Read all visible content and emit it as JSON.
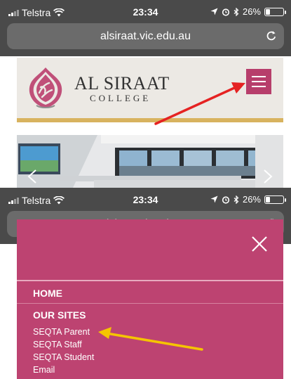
{
  "status_bar": {
    "carrier": "Telstra",
    "time": "23:34",
    "battery": "26%",
    "battery_level": 0.26
  },
  "browser": {
    "url": "alsiraat.vic.edu.au"
  },
  "site": {
    "name": "AL SIRAAT",
    "subtitle": "COLLEGE"
  },
  "menu": {
    "home_label": "HOME",
    "section_heading": "OUR SITES",
    "items": [
      {
        "label": "SEQTA Parent"
      },
      {
        "label": "SEQTA Staff"
      },
      {
        "label": "SEQTA Student"
      },
      {
        "label": "Email"
      }
    ]
  },
  "colors": {
    "brand_magenta": "#b73e6b",
    "menu_background": "#bd4371",
    "accent_gold": "#d8b35f",
    "browser_chrome": "#4a4a4a",
    "red_arrow": "#e52222",
    "yellow_arrow": "#f5c400"
  }
}
